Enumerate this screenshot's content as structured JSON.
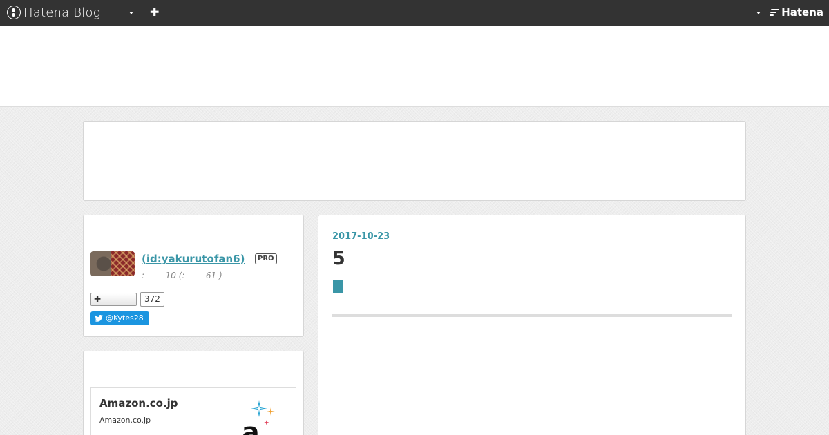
{
  "globalheader": {
    "logo_text": "Hatena Blog",
    "add_icon": "plus-icon",
    "brand_text": "Hatena"
  },
  "colors": {
    "header_bg": "#333333",
    "accent": "#3a96a7",
    "twitter": "#1b95e0"
  },
  "profile": {
    "name": " (id:yakurutofan6)",
    "badge": "PRO",
    "stats": ":        10 (:        61 )",
    "follow_count": "372",
    "twitter_handle": "@Kytes28"
  },
  "amazon": {
    "title": "Amazon.co.jp",
    "subtitle": "Amazon.co.jp",
    "logo_letter": "a"
  },
  "entry": {
    "date": "2017-10-23",
    "title": "5"
  }
}
